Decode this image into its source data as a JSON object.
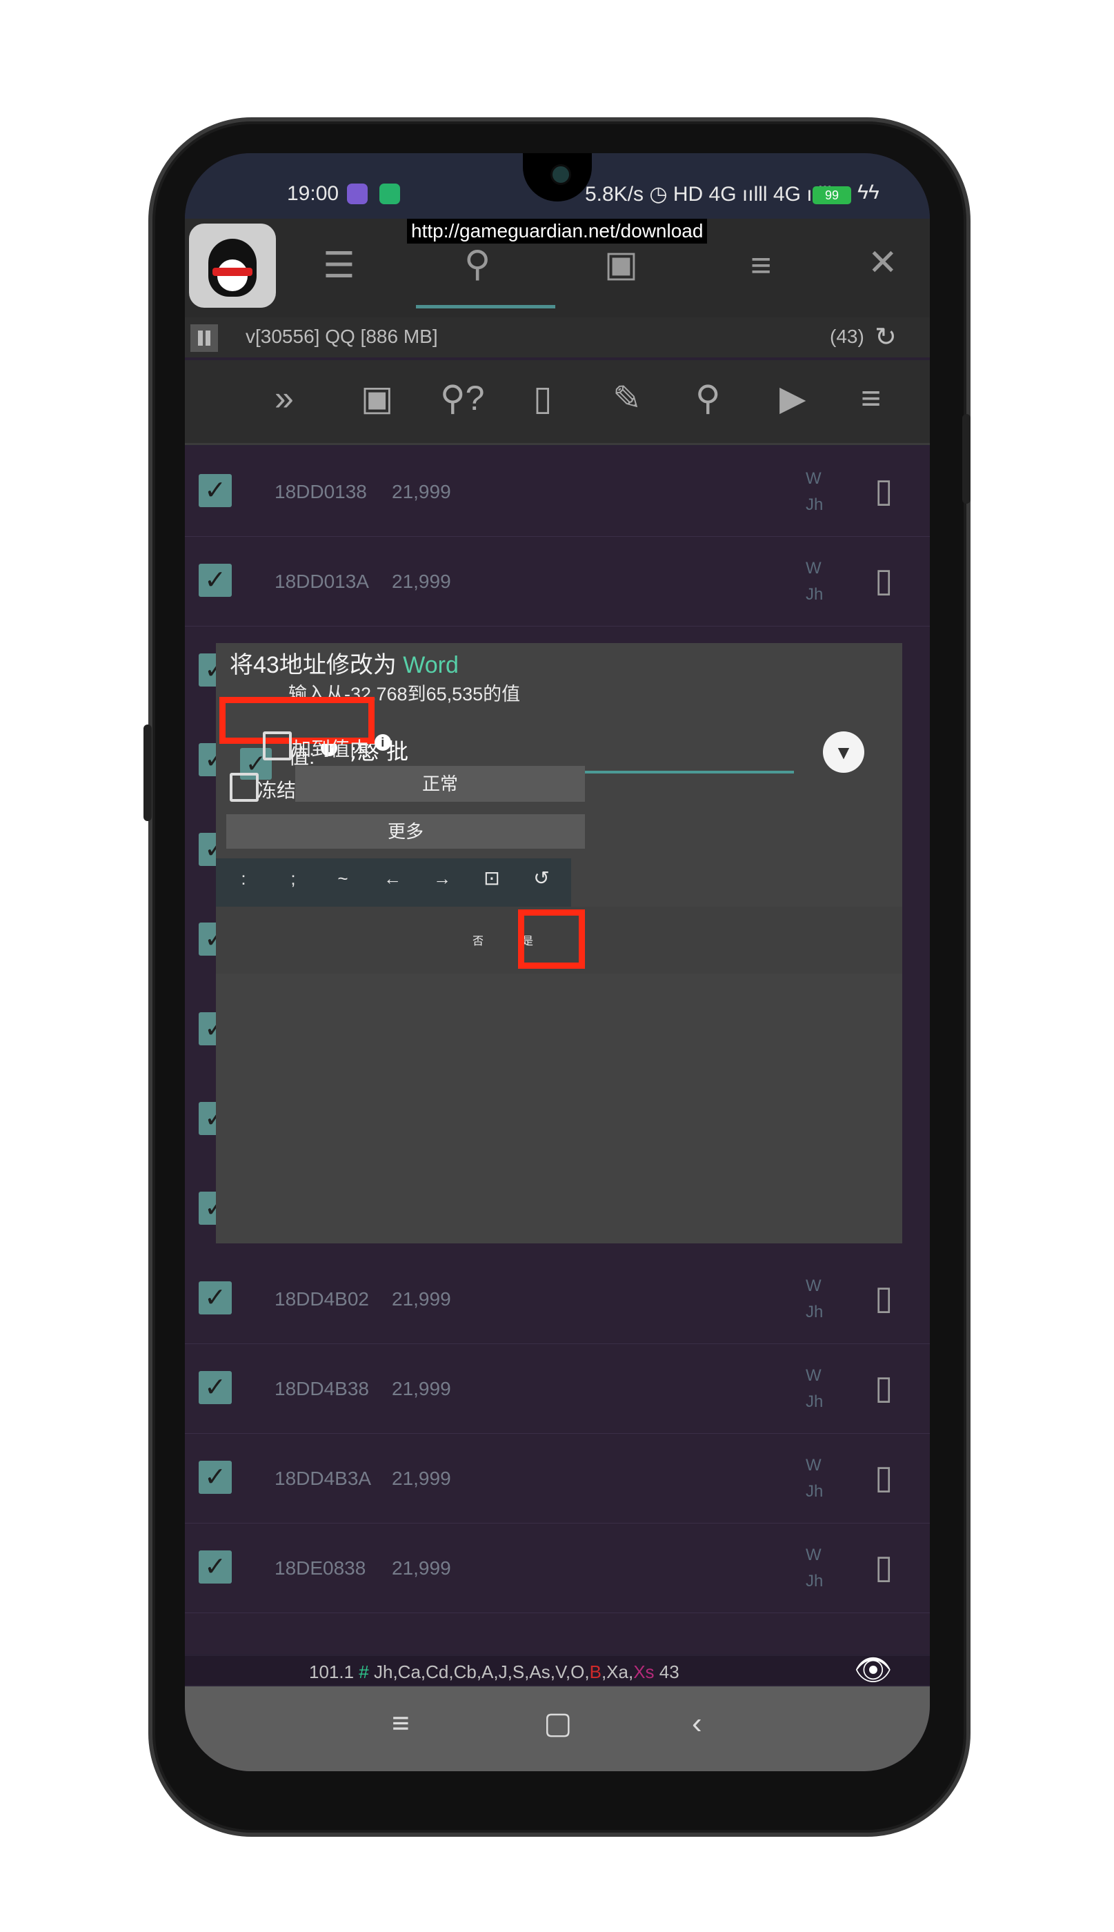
{
  "status_bar": {
    "time": "19:00",
    "right_text": "5.8K/s ◷ HD 4G ıılll 4G ıılll",
    "battery": "99"
  },
  "url_overlay": "http://gameguardian.net/download",
  "toolbar_icons": [
    "sliders-icon",
    "search-icon",
    "save-icon",
    "list-icon",
    "close-icon"
  ],
  "process": {
    "label": "v[30556] QQ [886 MB]",
    "count": "(43)"
  },
  "action_icons": [
    "fast-forward-icon",
    "save-icon",
    "search-unknown-icon",
    "delete-icon",
    "edit-icon",
    "search-icon",
    "play-icon",
    "menu-icon"
  ],
  "rows_top": [
    {
      "address": "18DD0138",
      "value": "21,999",
      "flag1": "W",
      "flag2": "Jh"
    },
    {
      "address": "18DD013A",
      "value": "21,999",
      "flag1": "W",
      "flag2": "Jh"
    }
  ],
  "rows_bottom": [
    {
      "address": "18DD4B02",
      "value": "21,999",
      "flag1": "W",
      "flag2": "Jh"
    },
    {
      "address": "18DD4B38",
      "value": "21,999",
      "flag1": "W",
      "flag2": "Jh"
    },
    {
      "address": "18DD4B3A",
      "value": "21,999",
      "flag1": "W",
      "flag2": "Jh"
    },
    {
      "address": "18DE0838",
      "value": "21,999",
      "flag1": "W",
      "flag2": "Jh"
    }
  ],
  "dialog": {
    "title_prefix": "将43地址修改为 ",
    "title_type": "Word",
    "subtitle": "输入从-32,768到65,535的值",
    "value_label": "值:",
    "value_input": ";憨 批",
    "add_to_value_label": "加到值内",
    "freeze_label": "冻结:",
    "freeze_mode": "正常",
    "more_label": "更多",
    "keys": [
      ":",
      ";",
      "~",
      "←",
      "→"
    ],
    "no_label": "否",
    "yes_label": "是"
  },
  "bottom_status": {
    "prefix": "101.1 ",
    "hash": "#",
    "flags": " Jh,Ca,Cd,Cb,A,J,S,As,V,O,",
    "red_flag": "B",
    "mid": ",Xa,",
    "pink_flag": "Xs",
    "count": " 43"
  },
  "colors": {
    "accent_teal": "#4c9a96",
    "highlight_red": "#ff2a13",
    "word_green": "#57d0a8"
  }
}
